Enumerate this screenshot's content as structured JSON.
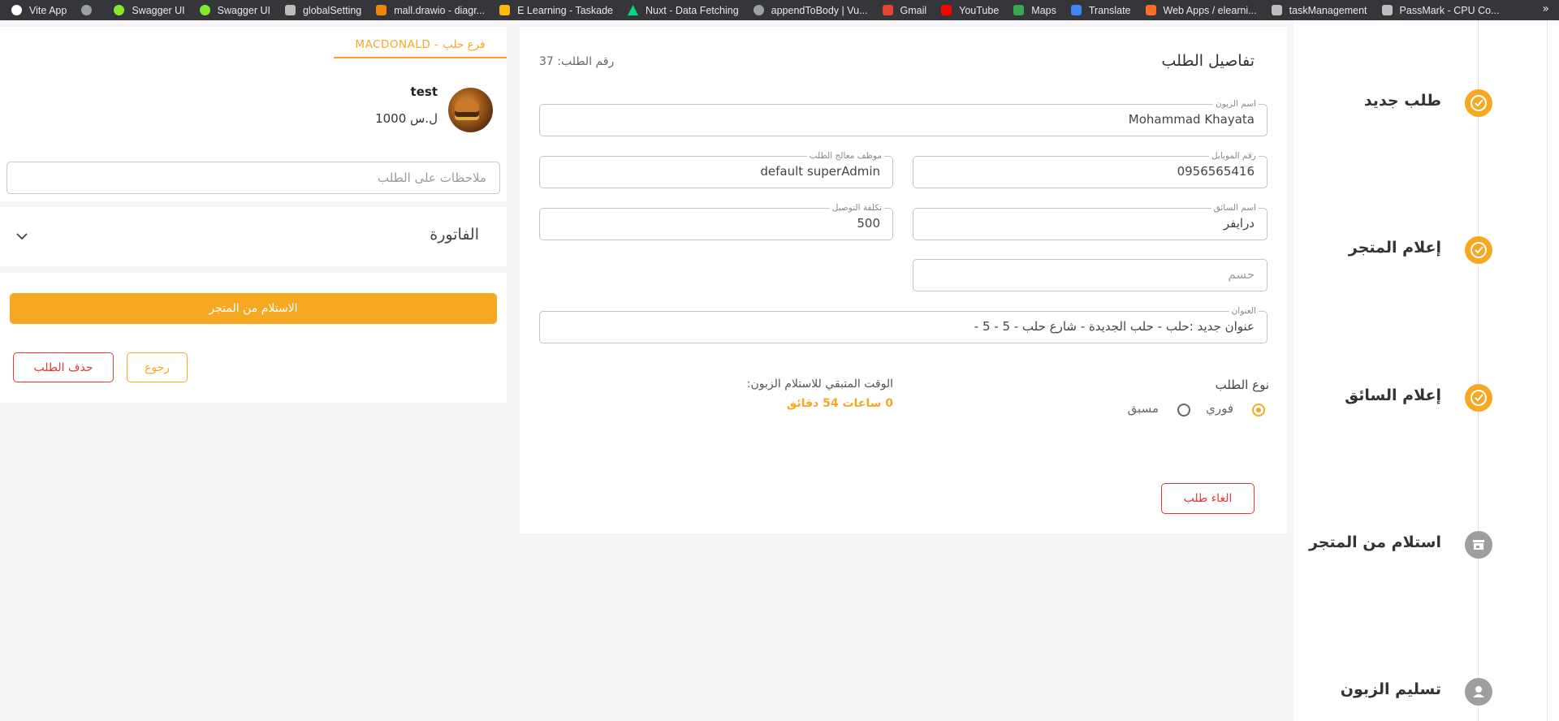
{
  "bookmarks": {
    "items": [
      {
        "label": "Vite App",
        "icon_color": "#ffffff"
      },
      {
        "label": "",
        "icon_color": "#9aa0a6"
      },
      {
        "label": "Swagger UI",
        "icon_color": "#85ea2d"
      },
      {
        "label": "Swagger UI",
        "icon_color": "#85ea2d"
      },
      {
        "label": "globalSetting",
        "icon_color": "#bdbdbd"
      },
      {
        "label": "mall.drawio - diagr...",
        "icon_color": "#f08705"
      },
      {
        "label": "E Learning - Taskade",
        "icon_color": "#fbbc05"
      },
      {
        "label": "Nuxt - Data Fetching",
        "icon_color": "#00dc82"
      },
      {
        "label": "appendToBody | Vu...",
        "icon_color": "#9aa0a6"
      },
      {
        "label": "Gmail",
        "icon_color": "#ea4335"
      },
      {
        "label": "YouTube",
        "icon_color": "#ff0000"
      },
      {
        "label": "Maps",
        "icon_color": "#34a853"
      },
      {
        "label": "Translate",
        "icon_color": "#4285f4"
      },
      {
        "label": "Web Apps / elearni...",
        "icon_color": "#fc6d26"
      },
      {
        "label": "taskManagement",
        "icon_color": "#bdbdbd"
      },
      {
        "label": "PassMark - CPU Co...",
        "icon_color": "#bdbdbd"
      }
    ],
    "more": "»"
  },
  "left": {
    "branch_tab": "MACDONALD - فرع حلب",
    "product": {
      "name": "test",
      "price": "1000 ل.س"
    },
    "notes_placeholder": "ملاحظات على الطلب",
    "invoice_title": "الفاتورة",
    "pickup_button": "الاستلام من المتجر",
    "back_button": "رجوع",
    "delete_button": "حذف الطلب"
  },
  "order": {
    "title": "تفاصيل الطلب",
    "number_text": "رقم الطلب: 37",
    "customer_name": {
      "label": "اسم الزبون",
      "value": "Mohammad Khayata"
    },
    "mobile": {
      "label": "رقم الموبايل",
      "value": "0956565416"
    },
    "handler": {
      "label": "موظف معالج الطلب",
      "value": "default superAdmin"
    },
    "driver": {
      "label": "اسم السائق",
      "value": "درايفر"
    },
    "delivery_cost": {
      "label": "تكلفة التوصيل",
      "value": "500"
    },
    "discount_placeholder": "حسم",
    "address": {
      "label": "العنوان",
      "value": "عنوان جديد :حلب - حلب الجديدة - شارع حلب - 5 - 5 -"
    },
    "order_type_label": "نوع الطلب",
    "type_options": [
      {
        "label": "فوري",
        "selected": true
      },
      {
        "label": "مسبق",
        "selected": false
      }
    ],
    "remaining_label": "الوقت المتبقي للاستلام الزبون:",
    "remaining_value": "0 ساعات 54 دقائق",
    "cancel_button": "الغاء طلب"
  },
  "stepper": {
    "steps": [
      {
        "label": "طلب جديد",
        "status": "done",
        "icon": "check-circle-icon"
      },
      {
        "label": "إعلام المتجر",
        "status": "done",
        "icon": "check-circle-icon"
      },
      {
        "label": "إعلام السائق",
        "status": "done",
        "icon": "check-circle-icon"
      },
      {
        "label": "استلام من المتجر",
        "status": "pending",
        "icon": "store-icon"
      },
      {
        "label": "تسليم الزبون",
        "status": "pending",
        "icon": "person-icon"
      }
    ]
  },
  "colors": {
    "accent": "#f7a823",
    "danger": "#e53935",
    "pending": "#9e9e9e"
  }
}
